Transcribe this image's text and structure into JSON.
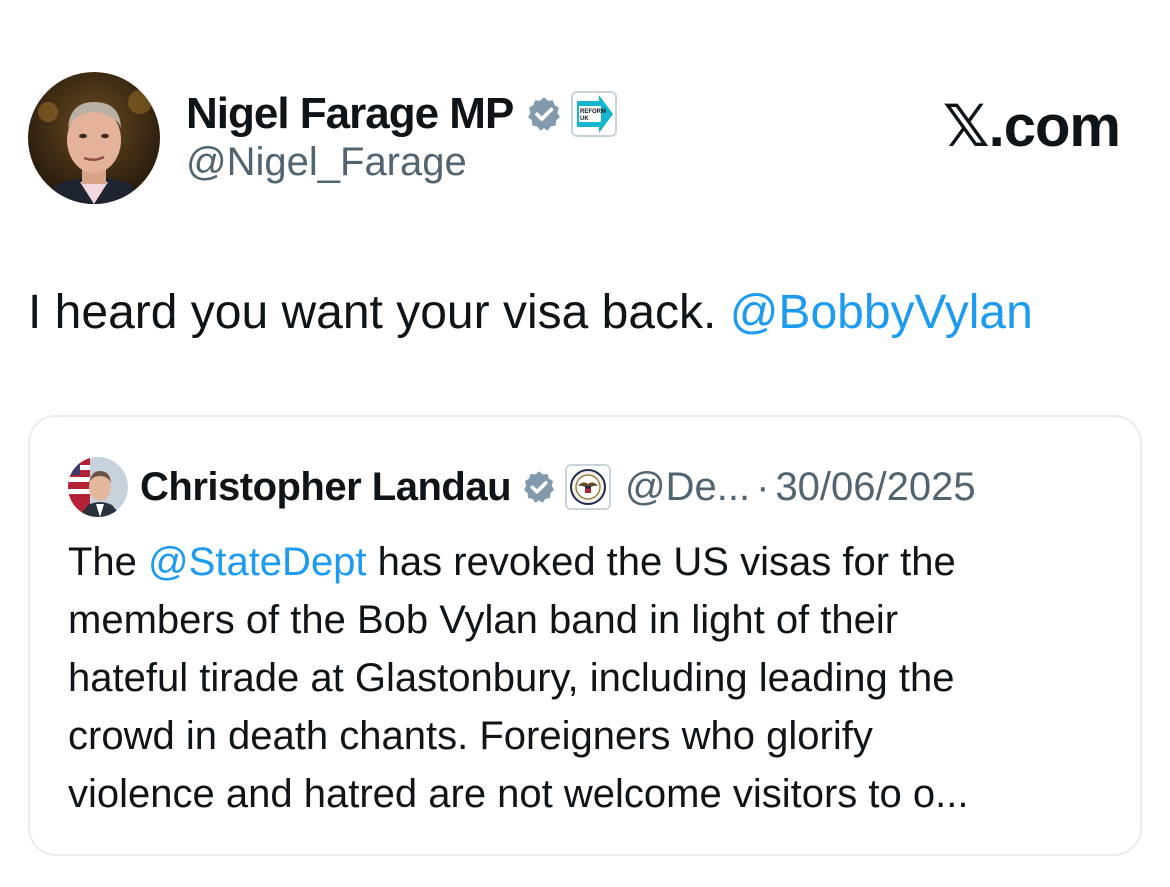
{
  "author": {
    "display_name": "Nigel Farage MP",
    "handle": "@Nigel_Farage",
    "verified_icon": "verified-badge-icon",
    "affiliate_badge_text": "REFORM UK"
  },
  "site_label": "𝕏.com",
  "tweet": {
    "text": "I heard you want your visa back. ",
    "mention": "@BobbyVylan"
  },
  "quoted_tweet": {
    "display_name": "Christopher Landau",
    "handle": "@De...",
    "separator": "·",
    "date": "30/06/2025",
    "text_lines": [
      {
        "before": "The ",
        "mention": "@StateDept",
        "after": " has revoked the US visas for the"
      },
      {
        "text": "members of the Bob Vylan band in light of their"
      },
      {
        "text": "hateful tirade at Glastonbury, including leading the"
      },
      {
        "text": "crowd in death chants. Foreigners who glorify"
      },
      {
        "text": "violence and hatred are not welcome visitors to o..."
      }
    ]
  },
  "colors": {
    "link": "#1d9bf0",
    "secondary_text": "#536471",
    "primary_text": "#0f1419",
    "verified_badge": "#829aab",
    "reform_teal": "#12b6cf"
  }
}
